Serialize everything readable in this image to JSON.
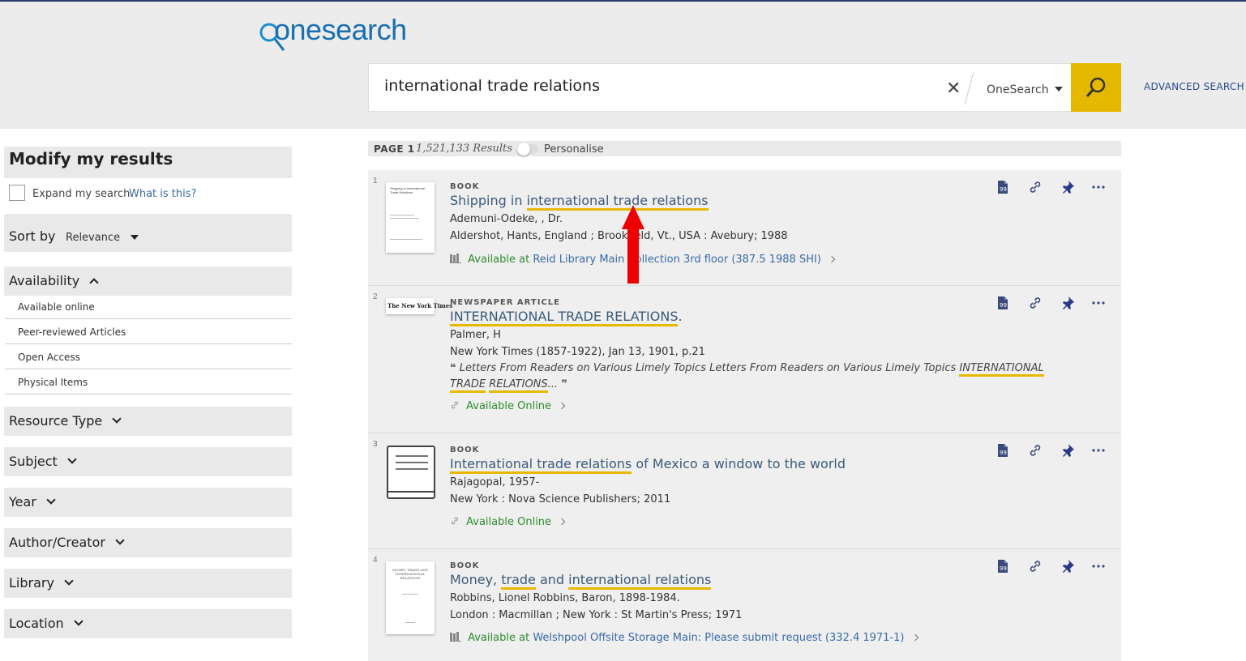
{
  "header": {
    "logo_text": "onesearch",
    "search_query": "international trade relations",
    "scope": "OneSearch",
    "advanced_search": "ADVANCED SEARCH"
  },
  "sidebar": {
    "title": "Modify my results",
    "expand_label": "Expand my search",
    "what_is_this": "What is this?",
    "sort_label": "Sort by",
    "sort_value": "Relevance",
    "availability_label": "Availability",
    "availability_items": [
      "Available online",
      "Peer-reviewed Articles",
      "Open Access",
      "Physical Items"
    ],
    "facets": [
      "Resource Type",
      "Subject",
      "Year",
      "Author/Creator",
      "Library",
      "Location"
    ]
  },
  "results_bar": {
    "page": "PAGE 1",
    "count": "1,521,133 Results",
    "personalise": "Personalise"
  },
  "results": [
    {
      "num": "1",
      "type": "BOOK",
      "title_prefix": "Shipping in ",
      "title_hl": "international trade relations",
      "author": "Ademuni-Odeke, , Dr.",
      "pub": "Aldershot, Hants, England ; Brookfield, Vt., USA : Avebury; 1988",
      "avail_green": "Available at",
      "avail_blue": "Reid Library",
      "avail_rest": "Main Collection 3rd floor (387.5 1988 SHI)"
    },
    {
      "num": "2",
      "type": "NEWSPAPER ARTICLE",
      "title_hl": "INTERNATIONAL TRADE RELATIONS",
      "title_suffix": ".",
      "author": "Palmer, H",
      "pub": "New York Times (1857-1922), Jan 13, 1901, p.21",
      "snippet_pre": "Letters From Readers on Various Limely Topics Letters From Readers on Various Limely Topics ",
      "snippet_hl1": "INTERNATIONAL",
      "snippet_hl2": "TRADE",
      "snippet_hl3": "RELATIONS",
      "snippet_post": "...",
      "avail_green": "Available Online"
    },
    {
      "num": "3",
      "type": "BOOK",
      "title_hl": "International trade relations",
      "title_suffix": " of Mexico a window to the world",
      "author": "Rajagopal, 1957-",
      "pub": "New York : Nova Science Publishers; 2011",
      "avail_green": "Available Online"
    },
    {
      "num": "4",
      "type": "BOOK",
      "title_prefix": "Money, ",
      "title_hl1": "trade",
      "title_mid": " and ",
      "title_hl2": "international relations",
      "author": "Robbins, Lionel Robbins, Baron, 1898-1984.",
      "pub": "London : Macmillan ; New York : St Martin's Press; 1971",
      "avail_green": "Available at",
      "avail_blue": "Welshpool",
      "avail_rest": "Offsite Storage Main: Please submit request (332.4 1971-1)"
    }
  ],
  "thumbs": {
    "r1_title": "Shipping in International Trade Relations",
    "r2_masthead": "The New York Times",
    "r4_title": "MONEY, TRADE AND INTERNATIONAL RELATIONS"
  },
  "colors": {
    "accent": "#e5b800",
    "link": "#3a6aa8",
    "available": "#2e8b2e",
    "highlight": "#e8b800"
  }
}
